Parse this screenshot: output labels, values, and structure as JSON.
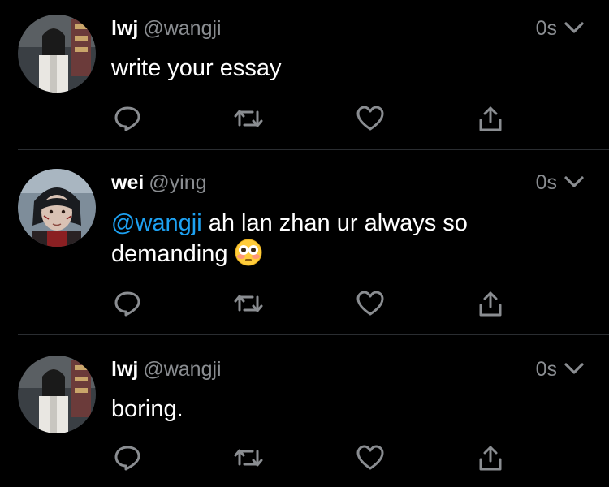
{
  "colors": {
    "background": "#000000",
    "text": "#ffffff",
    "muted": "#8a8d91",
    "mention": "#1da1f2",
    "divider": "#2a2d31"
  },
  "tweets": [
    {
      "display_name": "lwj",
      "handle": "@wangji",
      "time": "0s",
      "mention": "",
      "text": "write your essay",
      "avatar_icon": "avatar-lwj",
      "actions": [
        "reply-icon",
        "retweet-icon",
        "like-icon",
        "share-icon"
      ]
    },
    {
      "display_name": "wei",
      "handle": "@ying",
      "time": "0s",
      "mention": "@wangji",
      "text": " ah lan zhan ur always so demanding",
      "emoji": "flushed-face-emoji",
      "avatar_icon": "avatar-wei",
      "actions": [
        "reply-icon",
        "retweet-icon",
        "like-icon",
        "share-icon"
      ]
    },
    {
      "display_name": "lwj",
      "handle": "@wangji",
      "time": "0s",
      "mention": "",
      "text": "boring.",
      "avatar_icon": "avatar-lwj",
      "actions": [
        "reply-icon",
        "retweet-icon",
        "like-icon",
        "share-icon"
      ]
    }
  ]
}
